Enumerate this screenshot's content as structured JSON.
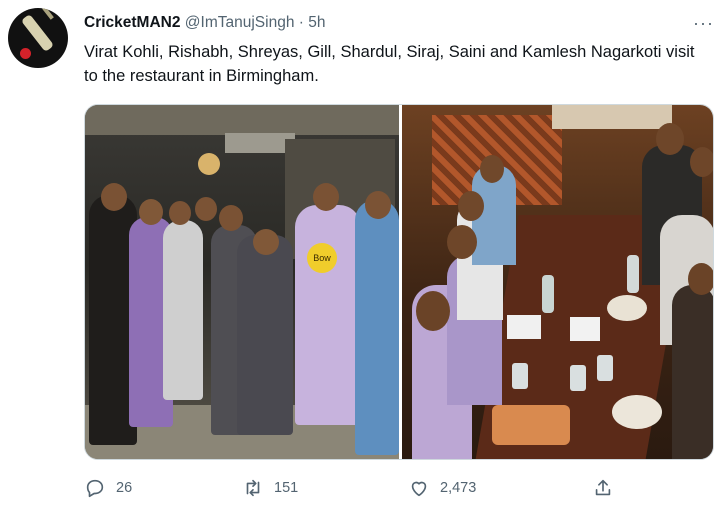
{
  "tweet": {
    "display_name": "CricketMAN2",
    "handle_time": "@ImTanujSingh · 5h",
    "more_label": "···",
    "text": "Virat Kohli, Rishabh, Shreyas, Gill, Shardul, Siraj, Saini and Kamlesh Nagarkoti visit to the restaurant in Birmingham.",
    "photo_overlay_text": "Bow"
  },
  "actions": {
    "reply_count": "26",
    "retweet_count": "151",
    "like_count": "2,473"
  },
  "colors": {
    "text_primary": "#0f1419",
    "text_secondary": "#536471",
    "border": "#cfd9de"
  },
  "icons": [
    "bat-and-ball-avatar",
    "more-icon",
    "reply-icon",
    "retweet-icon",
    "like-icon",
    "share-icon"
  ]
}
